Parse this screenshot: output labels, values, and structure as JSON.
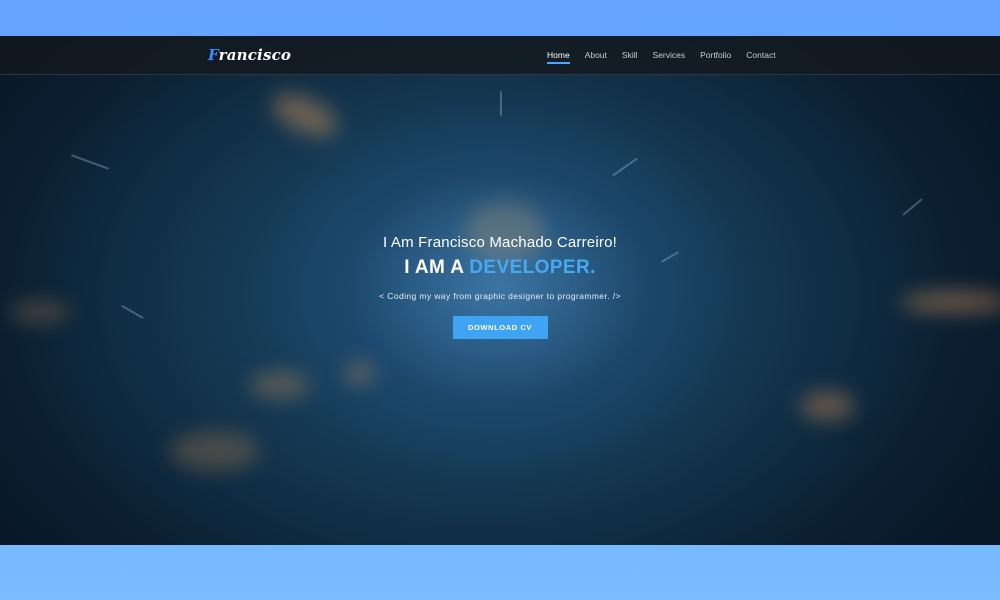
{
  "brand": {
    "logo_first": "F",
    "logo_rest": "rancisco"
  },
  "nav": {
    "items": [
      {
        "label": "Home",
        "active": true
      },
      {
        "label": "About",
        "active": false
      },
      {
        "label": "Skill",
        "active": false
      },
      {
        "label": "Services",
        "active": false
      },
      {
        "label": "Portfolio",
        "active": false
      },
      {
        "label": "Contact",
        "active": false
      }
    ]
  },
  "hero": {
    "greeting": "I Am Francisco Machado Carreiro!",
    "headline_prefix": "I AM A ",
    "headline_accent": "DEVELOPER.",
    "tagline": "< Coding my way from graphic designer to programmer. />",
    "button_label": "DOWNLOAD CV"
  },
  "colors": {
    "accent": "#45aaf2",
    "button": "#3fa4f4",
    "page_background": "#6aaeff",
    "hero_dark": "#0b1f31"
  }
}
